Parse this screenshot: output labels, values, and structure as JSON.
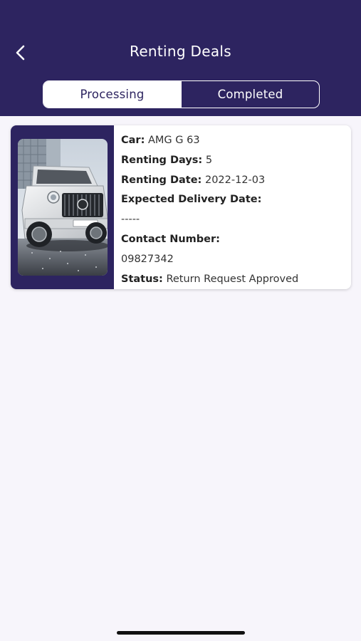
{
  "header": {
    "title": "Renting Deals",
    "back_icon": "chevron-left-icon"
  },
  "tabs": [
    {
      "label": "Processing",
      "active": true
    },
    {
      "label": "Completed",
      "active": false
    }
  ],
  "colors": {
    "primary": "#2d2460",
    "background": "#f7f5fb",
    "card": "#ffffff"
  },
  "deal": {
    "image": "car-photo",
    "car_label": "Car:",
    "car_value": "AMG G 63",
    "days_label": "Renting Days:",
    "days_value": "5",
    "date_label": "Renting Date:",
    "date_value": "2022-12-03",
    "delivery_label": "Expected Delivery Date:",
    "delivery_value": "-----",
    "contact_label": "Contact Number:",
    "contact_value": "09827342",
    "status_label": "Status:",
    "status_value": "Return Request Approved"
  }
}
